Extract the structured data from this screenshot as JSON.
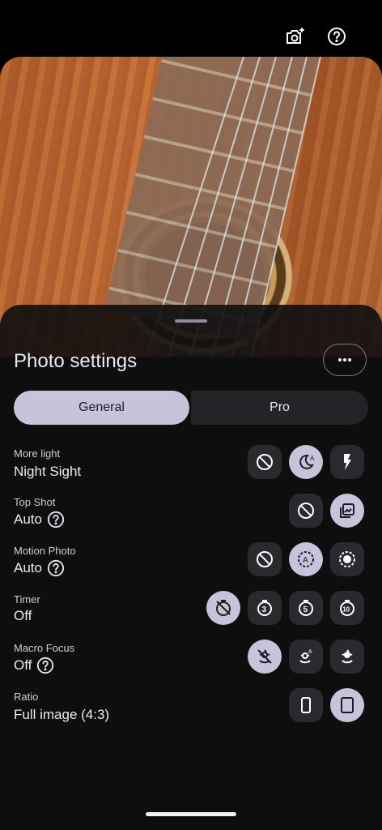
{
  "top_bar": {
    "icons": [
      "camera-sparkle-icon",
      "help-circle-icon"
    ]
  },
  "sheet": {
    "title": "Photo settings",
    "more_icon": "more-horiz-icon",
    "tabs": [
      {
        "label": "General",
        "selected": true
      },
      {
        "label": "Pro",
        "selected": false
      }
    ],
    "settings": [
      {
        "label": "More light",
        "value": "Night Sight",
        "help": false,
        "options": [
          "off-icon",
          "night-sight-auto-icon",
          "flash-icon"
        ],
        "selected": 1
      },
      {
        "label": "Top Shot",
        "value": "Auto",
        "help": true,
        "options": [
          "off-icon",
          "top-shot-auto-icon"
        ],
        "selected": 1
      },
      {
        "label": "Motion Photo",
        "value": "Auto",
        "help": true,
        "options": [
          "off-icon",
          "motion-auto-icon",
          "motion-on-icon"
        ],
        "selected": 1
      },
      {
        "label": "Timer",
        "value": "Off",
        "help": false,
        "options": [
          "timer-off-icon",
          "timer-3-icon",
          "timer-5-icon",
          "timer-10-icon"
        ],
        "selected": 0
      },
      {
        "label": "Macro Focus",
        "value": "Off",
        "help": true,
        "options": [
          "macro-off-icon",
          "macro-auto-icon",
          "macro-on-icon"
        ],
        "selected": 0
      },
      {
        "label": "Ratio",
        "value": "Full image (4:3)",
        "help": false,
        "options": [
          "ratio-full-icon",
          "ratio-4-3-icon"
        ],
        "selected": 1
      }
    ]
  },
  "colors": {
    "selected": "#c6c4da",
    "option_bg": "#2a292e",
    "sheet_bg": "#0e0e10"
  }
}
